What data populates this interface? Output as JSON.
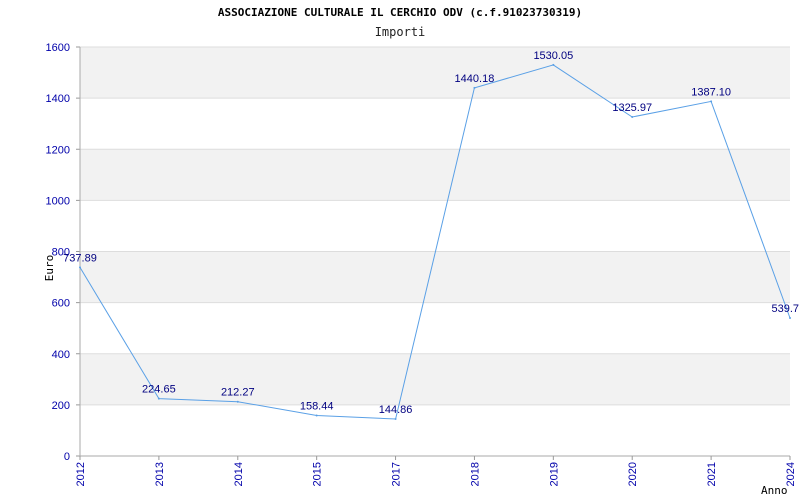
{
  "chart_data": {
    "type": "line",
    "title": "ASSOCIAZIONE CULTURALE IL CERCHIO ODV (c.f.91023730319)",
    "subtitle": "Importi",
    "xlabel": "Anno",
    "ylabel": "Euro",
    "ylim": [
      0,
      1600
    ],
    "yticks": [
      0,
      200,
      400,
      600,
      800,
      1000,
      1200,
      1400,
      1600
    ],
    "grid": true,
    "categories": [
      "2012",
      "2013",
      "2014",
      "2015",
      "2017",
      "2018",
      "2019",
      "2020",
      "2021",
      "2024"
    ],
    "series": [
      {
        "values": [
          737.89,
          224.65,
          212.27,
          158.44,
          144.86,
          1440.18,
          1530.05,
          1325.97,
          1387.1,
          539.7
        ],
        "labels": [
          "737.89",
          "224.65",
          "212.27",
          "158.44",
          "144.86",
          "1440.18",
          "1530.05",
          "1325.97",
          "1387.10",
          "539.7"
        ],
        "color": "#5aa0e6"
      }
    ]
  }
}
